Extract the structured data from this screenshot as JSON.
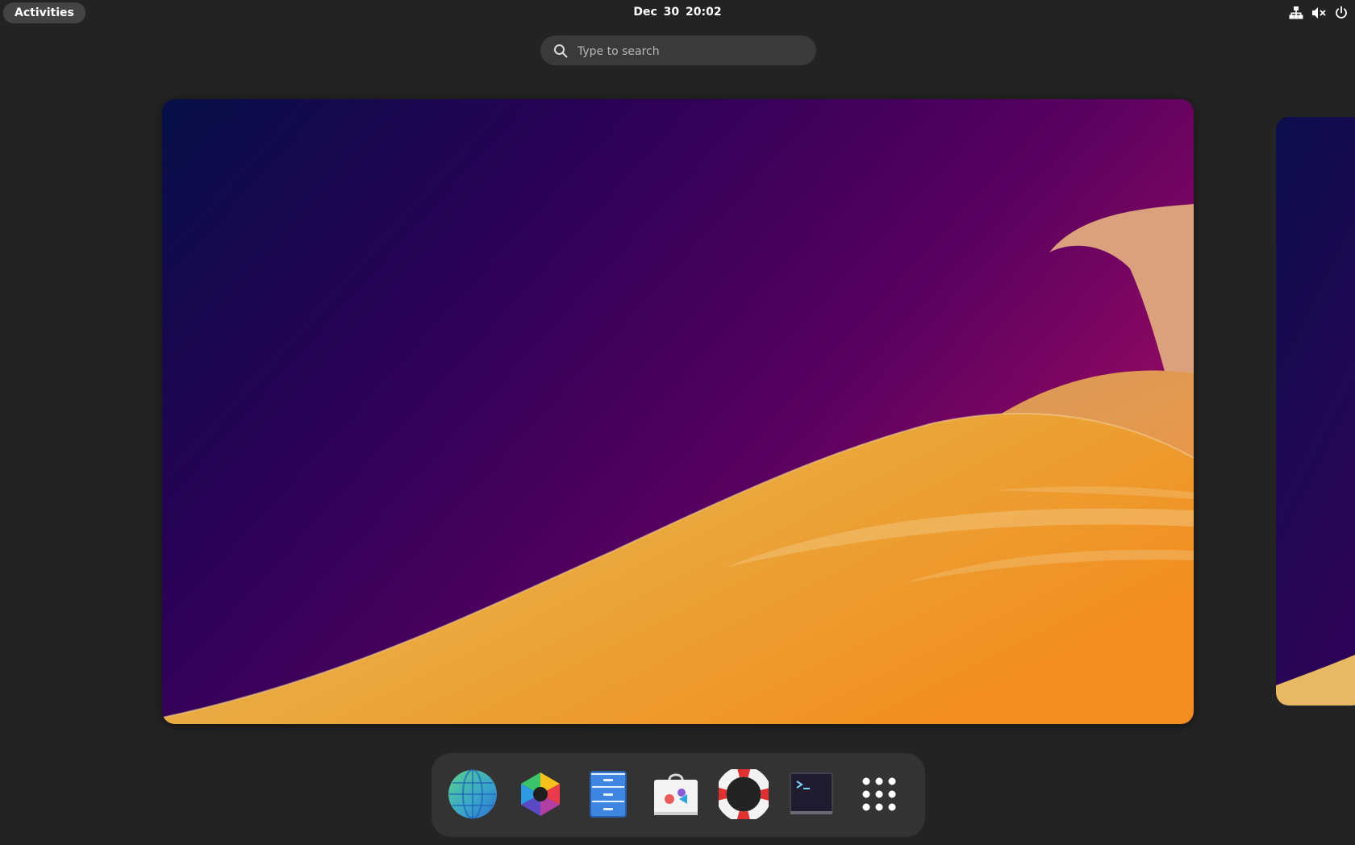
{
  "topbar": {
    "activities_label": "Activities",
    "clock": "Dec 30  20:02",
    "tray": [
      "network-wired-icon",
      "audio-muted-icon",
      "power-icon"
    ]
  },
  "search": {
    "placeholder": "Type to search"
  },
  "workspaces": {
    "count_visible": 2,
    "wallpaper_colors": [
      "#080f48",
      "#3a0058",
      "#8a0a66",
      "#f0a23a"
    ]
  },
  "dash": {
    "items": [
      {
        "app": "Web Browser",
        "icon": "globe-icon"
      },
      {
        "app": "Photo App",
        "icon": "color-hexagon-icon"
      },
      {
        "app": "Files",
        "icon": "file-cabinet-icon"
      },
      {
        "app": "Software",
        "icon": "shopping-bag-icon"
      },
      {
        "app": "Help",
        "icon": "lifebuoy-icon"
      },
      {
        "app": "Terminal",
        "icon": "terminal-icon"
      },
      {
        "app": "Show Apps",
        "icon": "app-grid-icon"
      }
    ]
  }
}
